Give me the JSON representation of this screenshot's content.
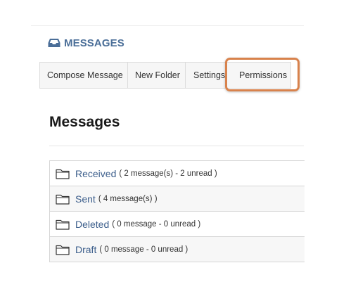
{
  "tool": {
    "title": "MESSAGES",
    "icon": "inbox-tray-icon",
    "accent_color": "#4a6e98"
  },
  "tabs": [
    {
      "label": "Compose Message"
    },
    {
      "label": "New Folder"
    },
    {
      "label": "Settings"
    },
    {
      "label": "Permissions"
    }
  ],
  "highlight": {
    "target": "Permissions",
    "color": "#d8824c"
  },
  "page": {
    "title": "Messages"
  },
  "folders": [
    {
      "name": "Received",
      "meta": "( 2 message(s) - 2 unread )",
      "icon": "folder-icon"
    },
    {
      "name": "Sent",
      "meta": "( 4 message(s) )",
      "icon": "folder-icon"
    },
    {
      "name": "Deleted",
      "meta": "( 0 message - 0 unread )",
      "icon": "folder-icon"
    },
    {
      "name": "Draft",
      "meta": "( 0 message - 0 unread )",
      "icon": "folder-icon"
    }
  ],
  "colors": {
    "link": "#3d5f8c",
    "tab_background": "#f6f6f6",
    "alt_row": "#f7f7f7"
  }
}
